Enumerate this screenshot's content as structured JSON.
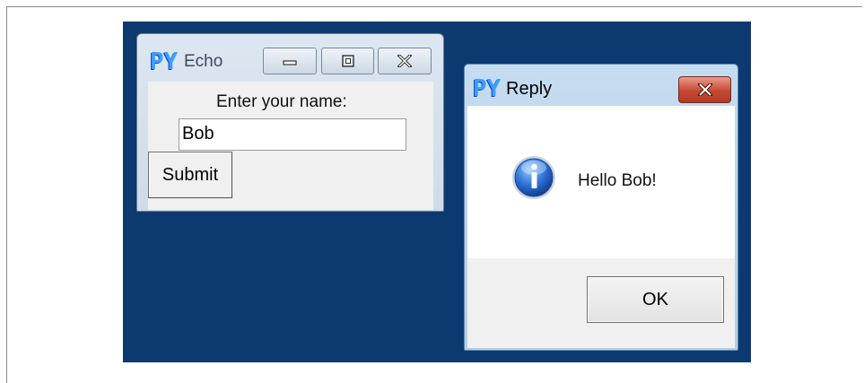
{
  "echo_window": {
    "title": "Echo",
    "icon": "python-logo-icon",
    "prompt_label": "Enter your name:",
    "name_value": "Bob",
    "submit_label": "Submit",
    "caption_buttons": [
      "minimize-icon",
      "maximize-icon",
      "close-icon"
    ]
  },
  "reply_dialog": {
    "title": "Reply",
    "icon": "python-logo-icon",
    "message_icon": "info-icon",
    "message": "Hello Bob!",
    "ok_label": "OK"
  },
  "colors": {
    "desktop": "#0c3a70",
    "close_button_red": "#c54932",
    "dialog_body": "#ffffff",
    "dialog_footer": "#f0f0f0"
  }
}
